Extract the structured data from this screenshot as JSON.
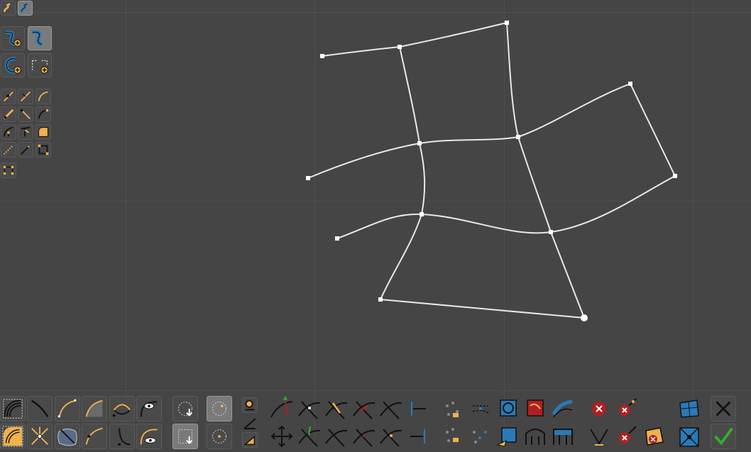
{
  "app": {
    "title": ""
  },
  "theme": {
    "background": "#454545",
    "grid": "#505050",
    "curve": "#e8e8e8",
    "accent": "#f0b050",
    "blue": "#2a7ab8",
    "delete": "#b02020",
    "ok": "#30b030"
  },
  "mode_buttons": [
    "spline-mode-icon",
    "spline-edit-mode-icon"
  ],
  "create_tools": [
    "add-spline-icon",
    "add-spline-active-icon",
    "add-circle-spline-icon",
    "add-rectangle-spline-icon"
  ],
  "edit_tools": [
    "line-tool-icon",
    "line-arrow-tool-icon",
    "curve-tool-icon",
    "segment-straight-icon",
    "segment-diagonal-icon",
    "segment-arc-icon",
    "branch-tool-icon",
    "branch-up-icon",
    "corner-round-icon",
    "dotted-line-icon",
    "knife-icon",
    "frame-select-icon",
    "node-grid-icon"
  ],
  "bottom_toolbar": {
    "row1": [
      "brush-dotted-icon",
      "line-single-icon",
      "curve-dotted-icon",
      "arc-filled-icon",
      "ellipse-arc-icon",
      "eye-curve-icon",
      "lasso-select-icon",
      "lasso-select-active-icon",
      "zoom-node-icon",
      "angle-icon",
      "node-split-green-icon",
      "node-cross-icon",
      "node-cross-orange-icon",
      "node-cross-red-icon",
      "node-cross-dark-icon",
      "align-horizontal-icon",
      "points-scatter-icon",
      "points-lines-icon",
      "close-curve-blue-icon",
      "close-curve-red-icon",
      "blend-blue-icon",
      "delete-node-icon",
      "delete-node-small-icon",
      "mesh-blue-icon",
      "cancel-icon"
    ],
    "row2": [
      "selection-rect-icon",
      "node-star-icon",
      "warp-icon",
      "curve-node-icon",
      "ellipse-select-icon",
      "eye-arc-icon",
      "rect-select-icon",
      "circle-select-icon",
      "angle-fill-icon",
      "move-icon",
      "node-split-icon",
      "node-cross-2-icon",
      "node-cross-3-icon",
      "node-cross-4-icon",
      "align-vertical-icon",
      "points-scatter-2-icon",
      "points-scatter-blue-icon",
      "mesh-orange-icon",
      "bridge-icon",
      "bridge-blue-icon",
      "v-split-icon",
      "delete-node-2-icon",
      "delete-blue-icon",
      "collapse-icon",
      "confirm-icon"
    ]
  }
}
